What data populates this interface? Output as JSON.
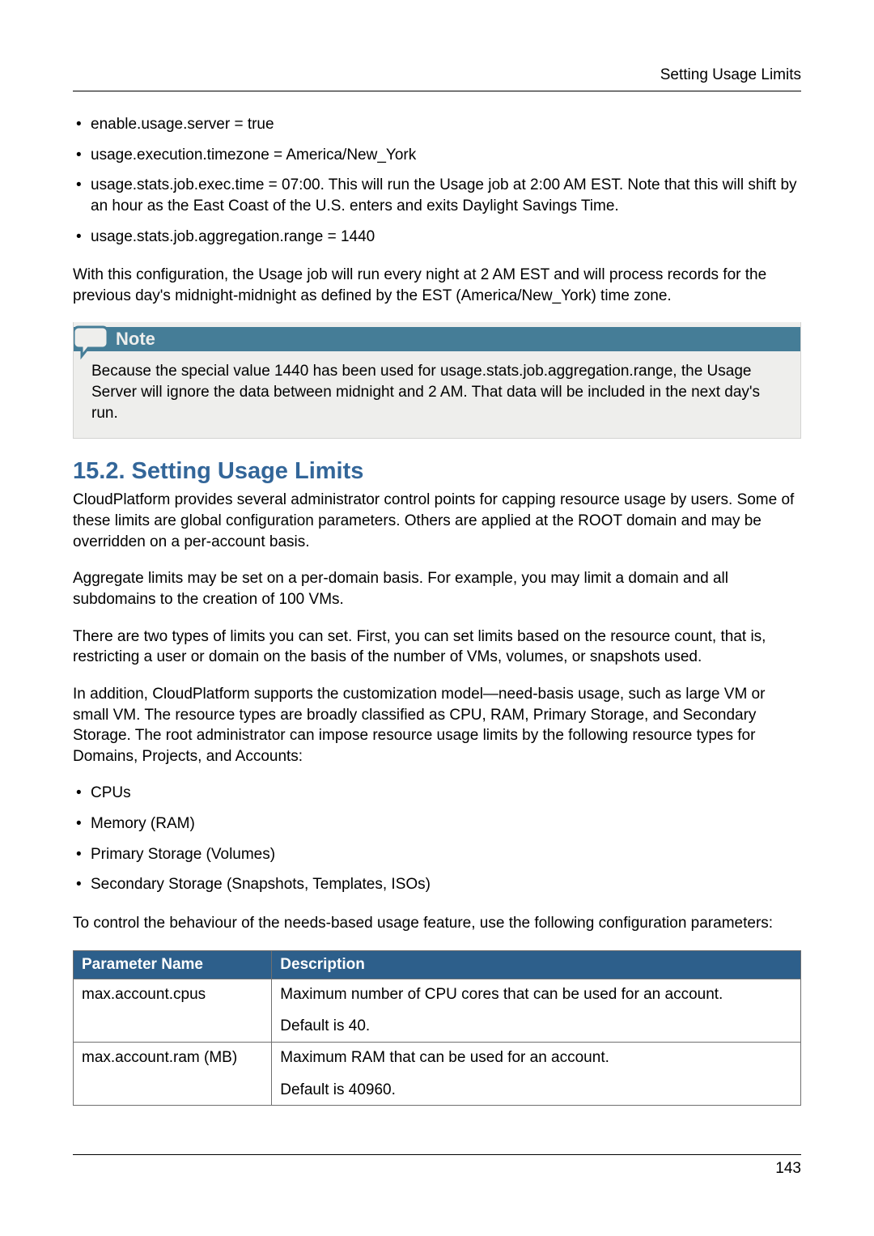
{
  "header": {
    "right": "Setting Usage Limits"
  },
  "bullets1": [
    "enable.usage.server = true",
    "usage.execution.timezone = America/New_York",
    "usage.stats.job.exec.time = 07:00. This will run the Usage job at 2:00 AM EST. Note that this will shift by an hour as the East Coast of the U.S. enters and exits Daylight Savings Time.",
    "usage.stats.job.aggregation.range = 1440"
  ],
  "para1": "With this configuration, the Usage job will run every night at 2 AM EST and will process records for the previous day's midnight-midnight as defined by the EST (America/New_York) time zone.",
  "note": {
    "label": "Note",
    "body": "Because the special value 1440 has been used for usage.stats.job.aggregation.range, the Usage Server will ignore the data between midnight and 2 AM. That data will be included in the next day's run."
  },
  "section": {
    "title": "15.2. Setting Usage Limits"
  },
  "para2": "CloudPlatform provides several administrator control points for capping resource usage by users. Some of these limits are global configuration parameters. Others are applied at the ROOT domain and may be overridden on a per-account basis.",
  "para3": "Aggregate limits may be set on a per-domain basis. For example, you may limit a domain and all subdomains to the creation of 100 VMs.",
  "para4": "There are two types of limits you can set. First, you can set limits based on the resource count, that is, restricting a user or domain on the basis of the number of VMs, volumes, or snapshots used.",
  "para5": "In addition, CloudPlatform supports the customization model—need-basis usage, such as large VM or small VM. The resource types are broadly classified as CPU, RAM, Primary Storage, and Secondary Storage. The root administrator can impose resource usage limits by the following resource types for Domains, Projects, and Accounts:",
  "bullets2": [
    "CPUs",
    "Memory (RAM)",
    "Primary Storage (Volumes)",
    "Secondary Storage (Snapshots, Templates, ISOs)"
  ],
  "para6": "To control the behaviour of the needs-based usage feature, use the following configuration parameters:",
  "table": {
    "headers": [
      "Parameter Name",
      "Description"
    ],
    "rows": [
      {
        "name": "max.account.cpus",
        "desc1": "Maximum number of CPU cores that can be used for an account.",
        "desc2": "Default is 40."
      },
      {
        "name": "max.account.ram (MB)",
        "desc1": "Maximum RAM that can be used for an account.",
        "desc2": "Default is 40960."
      }
    ]
  },
  "footer": {
    "page": "143"
  }
}
